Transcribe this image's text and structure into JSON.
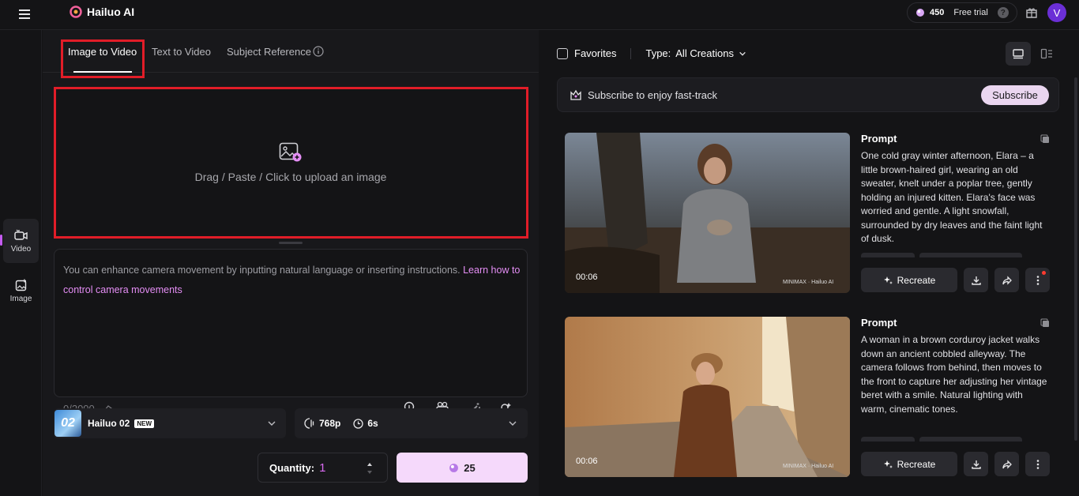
{
  "app": {
    "name": "Hailuo AI"
  },
  "header": {
    "credits": "450",
    "trial_label": "Free trial",
    "help": "?",
    "avatar_initial": "V"
  },
  "rail": {
    "items": [
      {
        "label": "Video"
      },
      {
        "label": "Image"
      }
    ]
  },
  "tabs": [
    {
      "label": "Image to Video"
    },
    {
      "label": "Text to Video"
    },
    {
      "label": "Subject Reference"
    }
  ],
  "upload": {
    "text": "Drag / Paste / Click to upload an image"
  },
  "prompt": {
    "placeholder": "You can enhance camera movement by inputting natural language or inserting instructions. ",
    "link": "Learn how to control camera movements",
    "counter": "0/2000"
  },
  "model": {
    "name": "Hailuo 02",
    "badge": "NEW",
    "thumb_text": "02"
  },
  "settings": {
    "resolution": "768p",
    "duration": "6s"
  },
  "quantity": {
    "label": "Quantity:",
    "value": "1"
  },
  "generate": {
    "cost": "25"
  },
  "filters": {
    "favorites": "Favorites",
    "type_label": "Type:",
    "type_value": "All Creations"
  },
  "subscribe": {
    "text": "Subscribe to enjoy fast-track",
    "button": "Subscribe"
  },
  "cards": [
    {
      "title": "Prompt",
      "text": "One cold gray winter afternoon, Elara – a little brown-haired girl, wearing an old sweater, knelt under a poplar tree, gently holding an injured kitten. Elara's face was worried and gentle. A light snowfall, surrounded by dry leaves and the faint light of dusk.",
      "duration": "00:06",
      "watermark": "MINIMAX · Hailuo AI",
      "recreate": "Recreate"
    },
    {
      "title": "Prompt",
      "text": "A woman in a brown corduroy jacket walks down an ancient cobbled alleyway. The camera follows from behind, then moves to the front to capture her adjusting her vintage beret with a smile. Natural lighting with warm, cinematic tones.",
      "duration": "00:06",
      "watermark": "MINIMAX · Hailuo AI",
      "recreate": "Recreate"
    }
  ],
  "colors": {
    "accent": "#d86af0",
    "highlight_box": "#e11d28",
    "generate_bg": "#f5d9fb",
    "subscribe_bg": "#ead6f0"
  }
}
